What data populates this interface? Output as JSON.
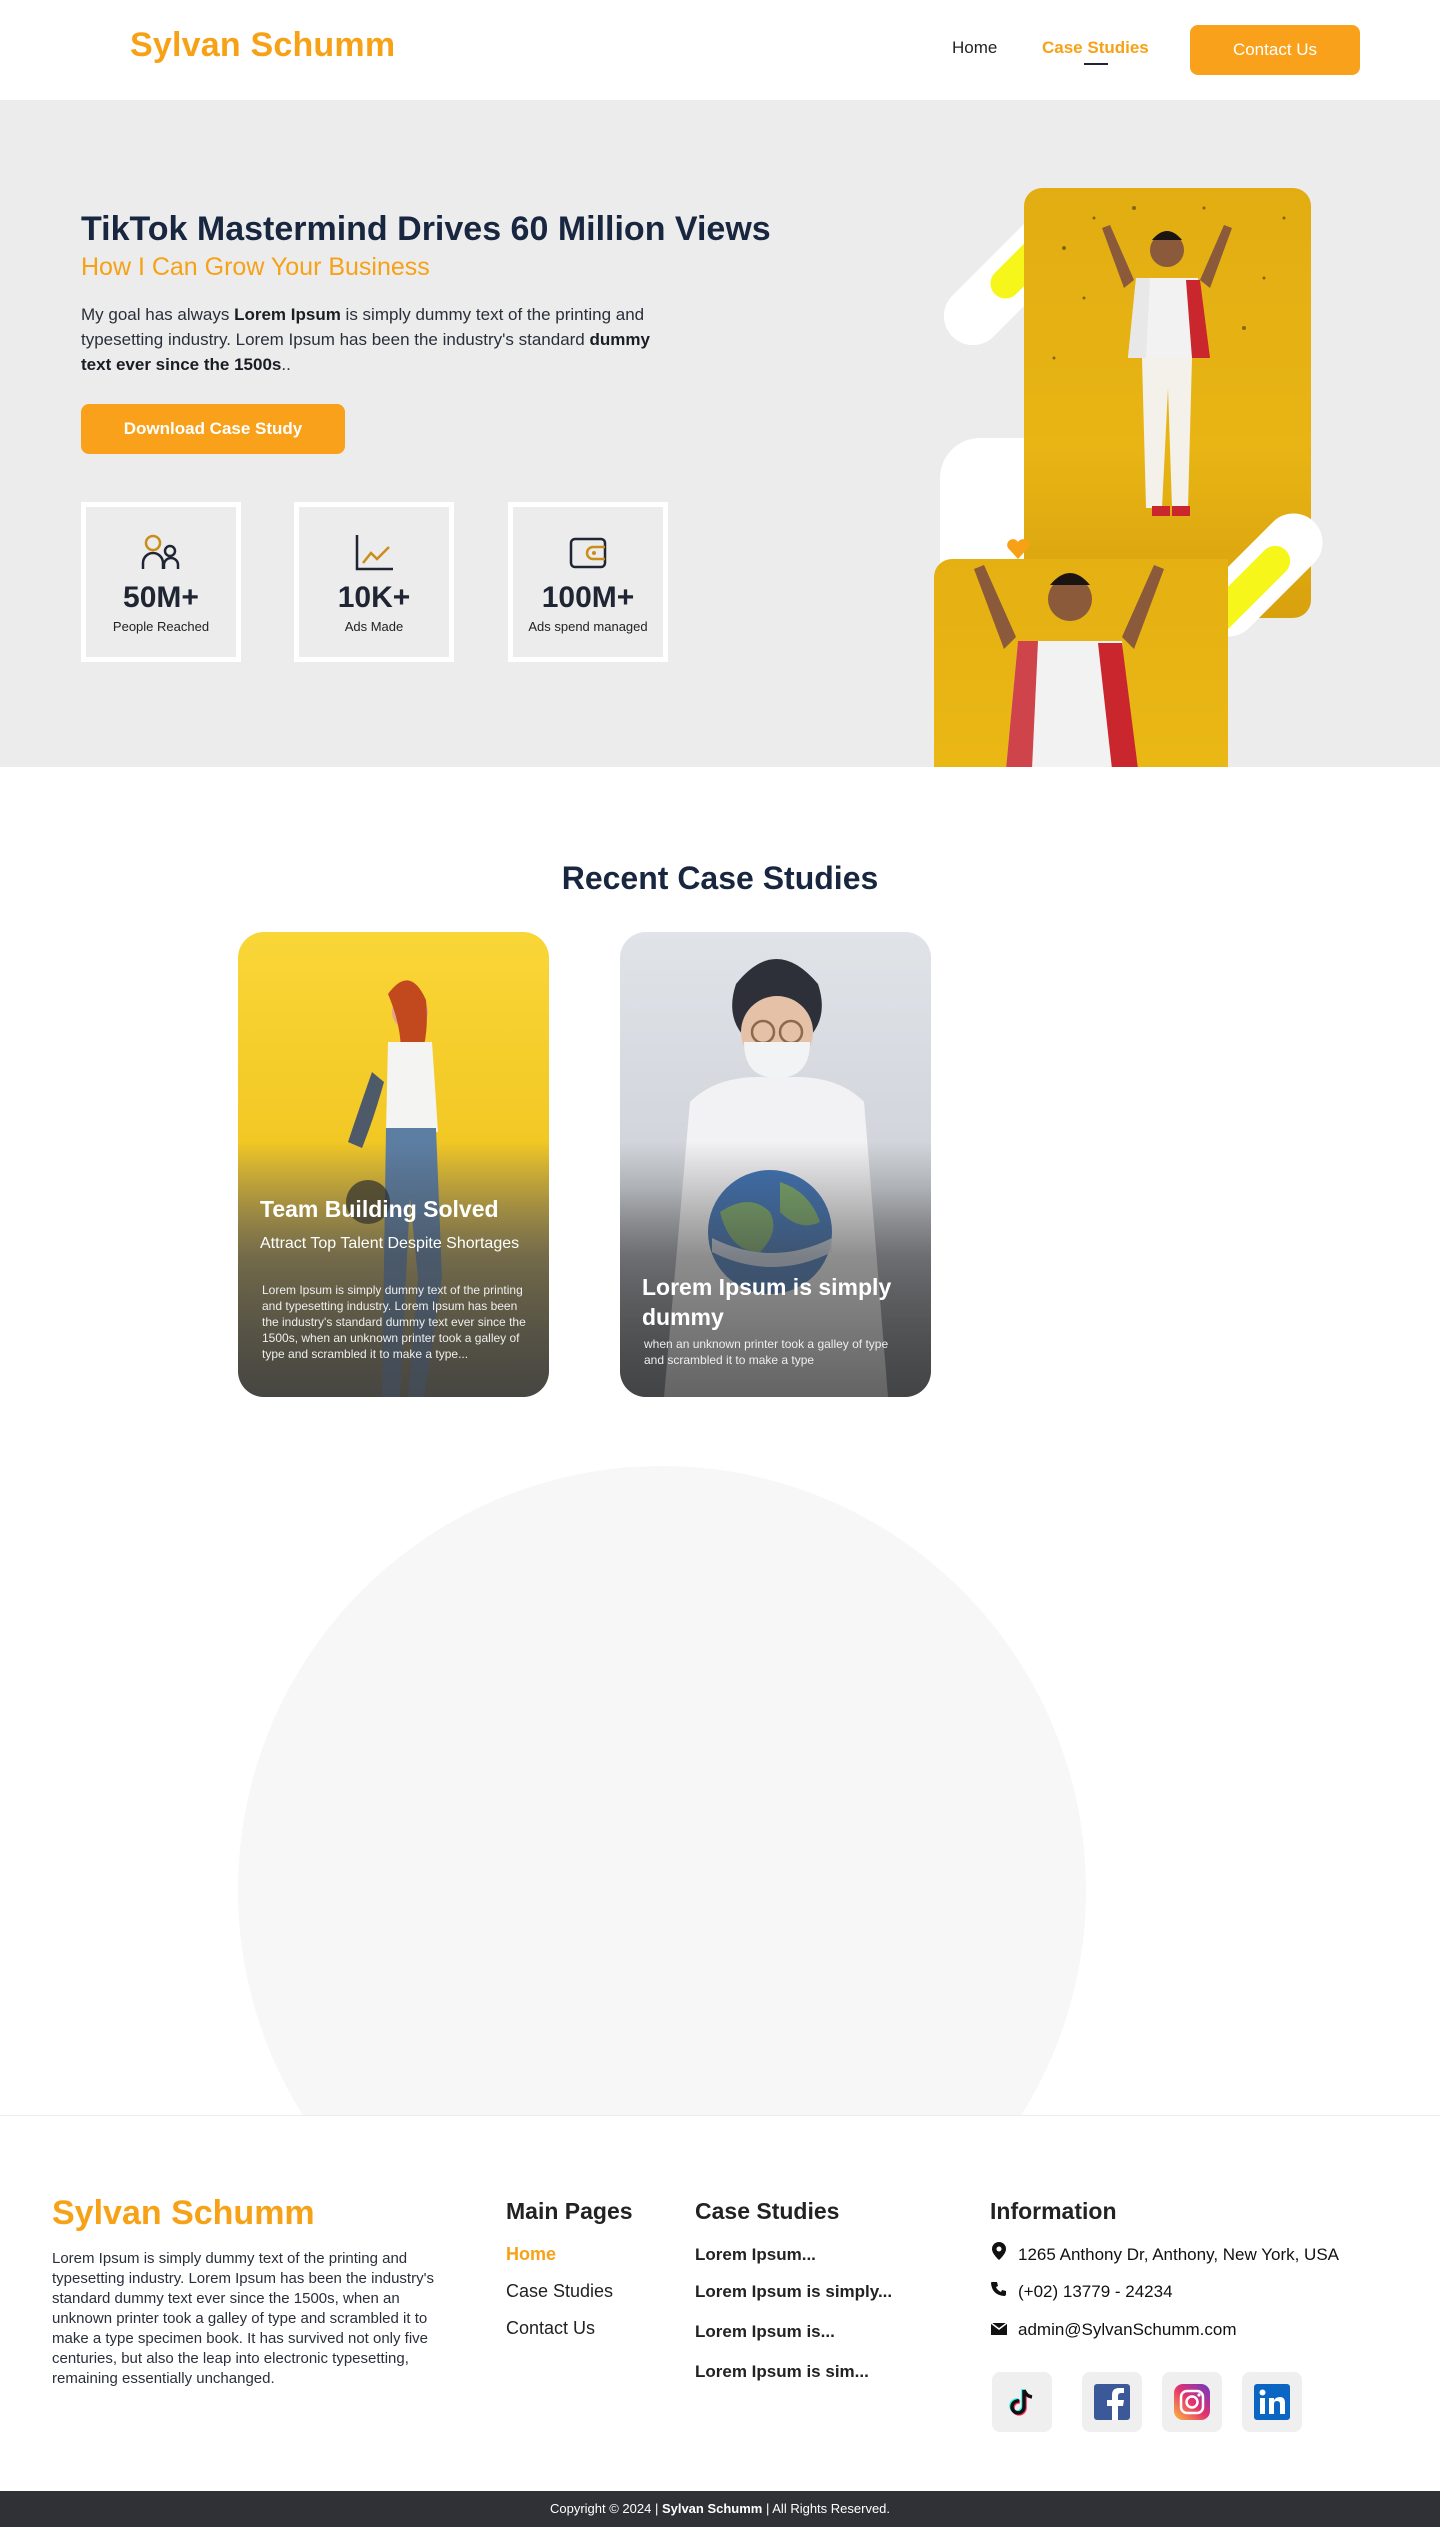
{
  "header": {
    "logo": "Sylvan Schumm",
    "nav": {
      "home": "Home",
      "case_studies": "Case Studies"
    },
    "contact_label": "Contact Us"
  },
  "hero": {
    "title": "TikTok Mastermind Drives 60 Million Views",
    "subtitle": "How I Can Grow Your Business",
    "text_1": "My goal has always ",
    "text_bold_1": "Lorem Ipsum",
    "text_2": " is simply dummy text of the printing and typesetting industry. Lorem Ipsum has been the industry's standard ",
    "text_bold_2": "dummy text ever since the 1500s",
    "text_3": "..",
    "download_label": "Download Case Study",
    "stats": [
      {
        "icon": "people-icon",
        "value": "50M+",
        "label": "People Reached"
      },
      {
        "icon": "chart-line-icon",
        "value": "10K+",
        "label": "Ads Made"
      },
      {
        "icon": "wallet-icon",
        "value": "100M+",
        "label": "Ads spend managed"
      }
    ]
  },
  "recent": {
    "title": "Recent Case Studies",
    "cards": [
      {
        "title": "Team Building Solved",
        "subtitle": "Attract Top Talent Despite Shortages",
        "desc": "Lorem Ipsum is simply dummy text of the printing and typesetting industry. Lorem Ipsum has been the industry's standard dummy text ever since the 1500s, when an unknown printer took a galley of type and scrambled it to make a type..."
      },
      {
        "title": "Lorem Ipsum is simply dummy",
        "desc": "when an unknown printer took a galley of type and scrambled it to make a type"
      }
    ]
  },
  "footer": {
    "logo": "Sylvan Schumm",
    "about": "Lorem Ipsum is simply dummy text of the printing and typesetting industry. Lorem Ipsum has been the industry's standard dummy text ever since the 1500s, when an unknown printer took a galley of type and scrambled it to make a type specimen book. It has survived not only five centuries, but also the leap into electronic typesetting, remaining essentially unchanged.",
    "main_pages": {
      "title": "Main Pages",
      "links": [
        "Home",
        "Case Studies",
        "Contact Us"
      ]
    },
    "case_studies": {
      "title": "Case Studies",
      "links": [
        "Lorem Ipsum...",
        "Lorem Ipsum is simply...",
        "Lorem Ipsum is...",
        "Lorem Ipsum is sim..."
      ]
    },
    "information": {
      "title": "Information",
      "address": "1265 Anthony Dr, Anthony, New York, USA",
      "phone": "(+02) 13779 - 24234",
      "email": "admin@SylvanSchumm.com"
    },
    "socials": [
      "tiktok-icon",
      "facebook-icon",
      "instagram-icon",
      "linkedin-icon"
    ],
    "copyright_prefix": "Copyright © 2024 | ",
    "copyright_name": "Sylvan Schumm",
    "copyright_suffix": " | All Rights Reserved."
  },
  "colors": {
    "accent": "#f7a116",
    "navy": "#182640",
    "hero_bg": "#ececec",
    "footer_bar": "#2f3136"
  }
}
